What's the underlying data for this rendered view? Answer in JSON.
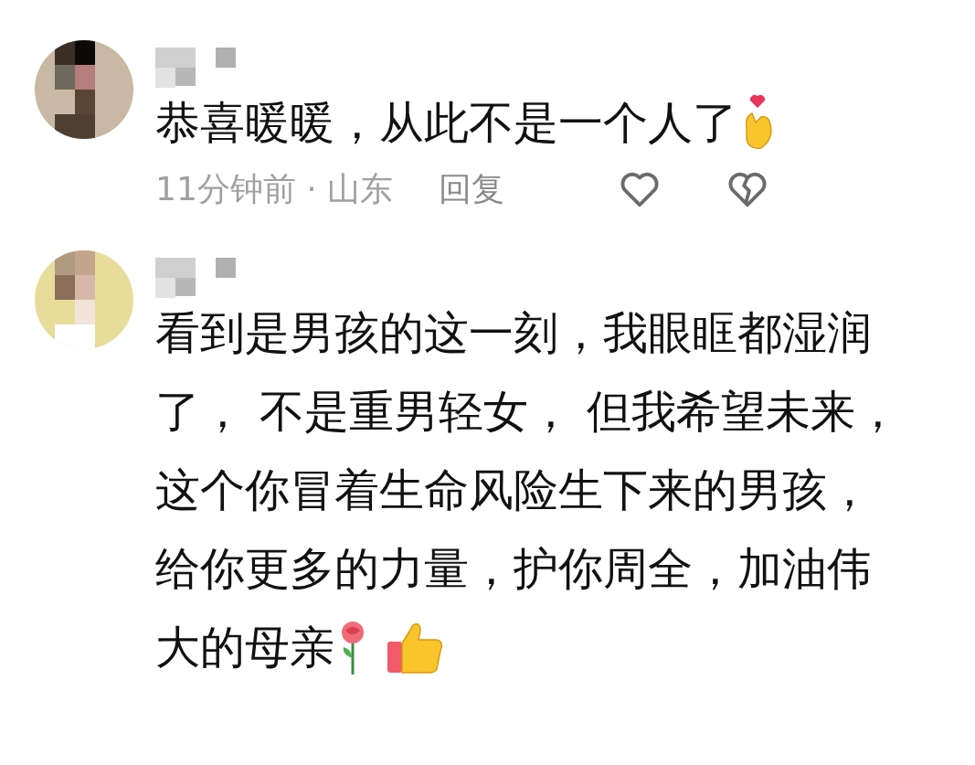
{
  "comments": [
    {
      "lines": [
        "恭喜暖暖，从此不是一个人了"
      ],
      "emojis": [
        {
          "kind": "finger-heart"
        }
      ],
      "meta": {
        "time": "11分钟前 · 山东",
        "reply": "回复"
      }
    },
    {
      "lines": [
        "看到是男孩的这一刻，我眼眶都湿润",
        "了， 不是重男轻女， 但我希望未来，",
        "这个你冒着生命风险生下来的男孩，",
        "给你更多的力量，护你周全，加油伟",
        "大的母亲"
      ],
      "emojis": [
        {
          "kind": "rose"
        },
        {
          "kind": "thumbs-up"
        }
      ]
    }
  ]
}
